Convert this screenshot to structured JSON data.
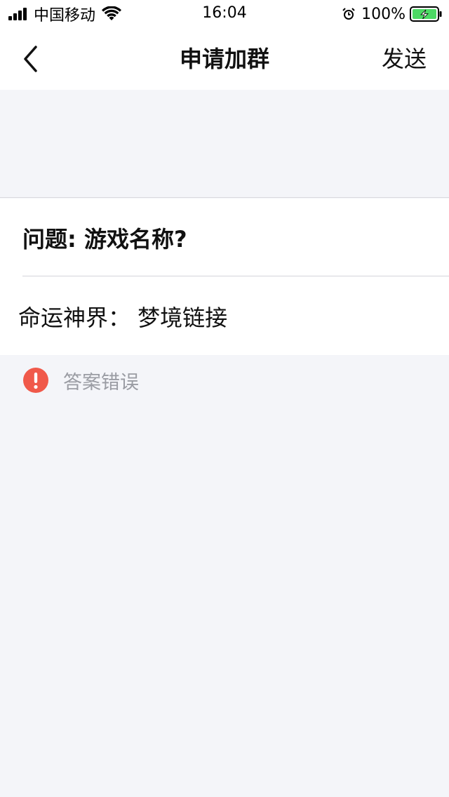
{
  "status_bar": {
    "carrier": "中国移动",
    "time": "16:04",
    "battery": "100%"
  },
  "nav": {
    "title": "申请加群",
    "send_label": "发送"
  },
  "question": {
    "text": "问题: 游戏名称?"
  },
  "answer": {
    "value": "命运神界： 梦境链接"
  },
  "error": {
    "text": "答案错误"
  },
  "colors": {
    "error_icon": "#f0594a",
    "battery_green": "#4cd964",
    "background": "#f4f5f9"
  },
  "icons": [
    "signal-icon",
    "wifi-icon",
    "alarm-icon",
    "battery-icon",
    "back-chevron-icon",
    "exclamation-icon"
  ]
}
